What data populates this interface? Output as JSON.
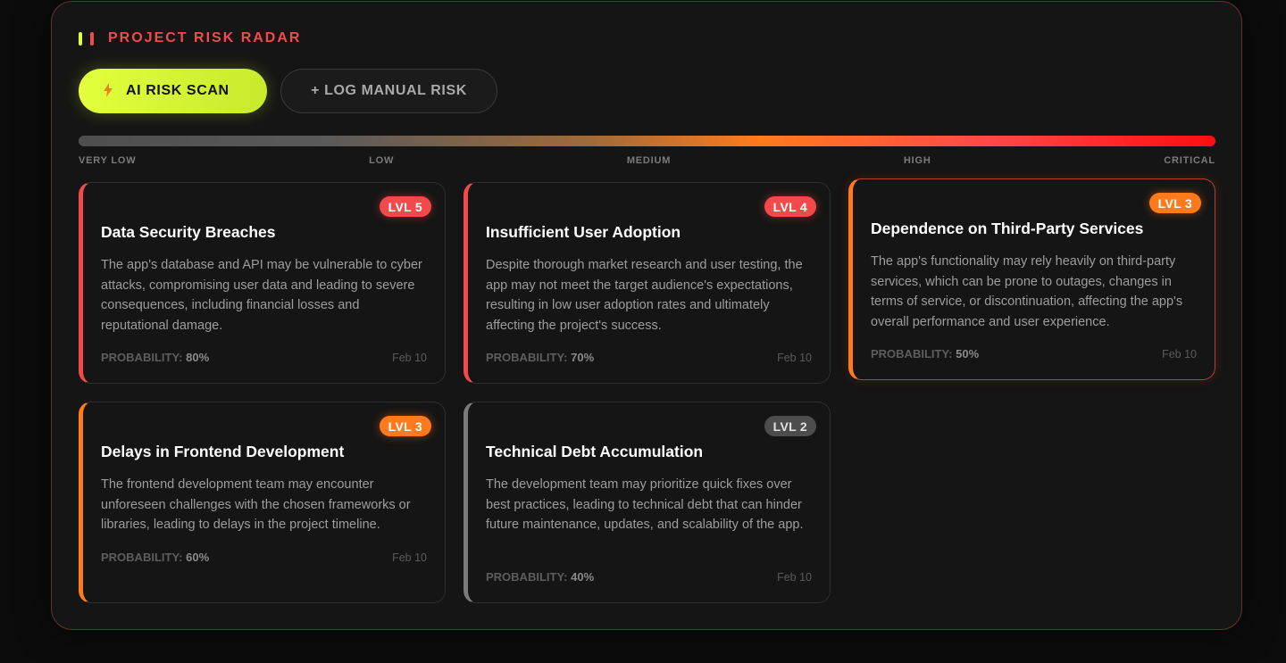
{
  "header": {
    "title": "PROJECT RISK RADAR",
    "bar_colors": [
      "#e3ff3c",
      "#f24b4b"
    ]
  },
  "actions": {
    "ai_scan_label": "AI RISK SCAN",
    "ai_scan_icon": "lightning-bolt-icon",
    "manual_label": "+ LOG MANUAL RISK"
  },
  "scale": {
    "labels": [
      "VERY LOW",
      "LOW",
      "MEDIUM",
      "HIGH",
      "CRITICAL"
    ]
  },
  "risks": [
    {
      "level": "LVL 5",
      "title": "Data Security Breaches",
      "description": "The app's database and API may be vulnerable to cyber attacks, compromising user data and leading to severe consequences, including financial losses and reputational damage.",
      "probability_label": "PROBABILITY:",
      "probability": "80%",
      "date": "Feb 10"
    },
    {
      "level": "LVL 4",
      "title": "Insufficient User Adoption",
      "description": "Despite thorough market research and user testing, the app may not meet the target audience's expectations, resulting in low user adoption rates and ultimately affecting the project's success.",
      "probability_label": "PROBABILITY:",
      "probability": "70%",
      "date": "Feb 10"
    },
    {
      "level": "LVL 3",
      "title": "Dependence on Third-Party Services",
      "description": "The app's functionality may rely heavily on third-party services, which can be prone to outages, changes in terms of service, or discontinuation, affecting the app's overall performance and user experience.",
      "probability_label": "PROBABILITY:",
      "probability": "50%",
      "date": "Feb 10"
    },
    {
      "level": "LVL 3",
      "title": "Delays in Frontend Development",
      "description": "The frontend development team may encounter unforeseen challenges with the chosen frameworks or libraries, leading to delays in the project timeline.",
      "probability_label": "PROBABILITY:",
      "probability": "60%",
      "date": "Feb 10"
    },
    {
      "level": "LVL 2",
      "title": "Technical Debt Accumulation",
      "description": "The development team may prioritize quick fixes over best practices, leading to technical debt that can hinder future maintenance, updates, and scalability of the app.",
      "probability_label": "PROBABILITY:",
      "probability": "40%",
      "date": "Feb 10"
    }
  ]
}
